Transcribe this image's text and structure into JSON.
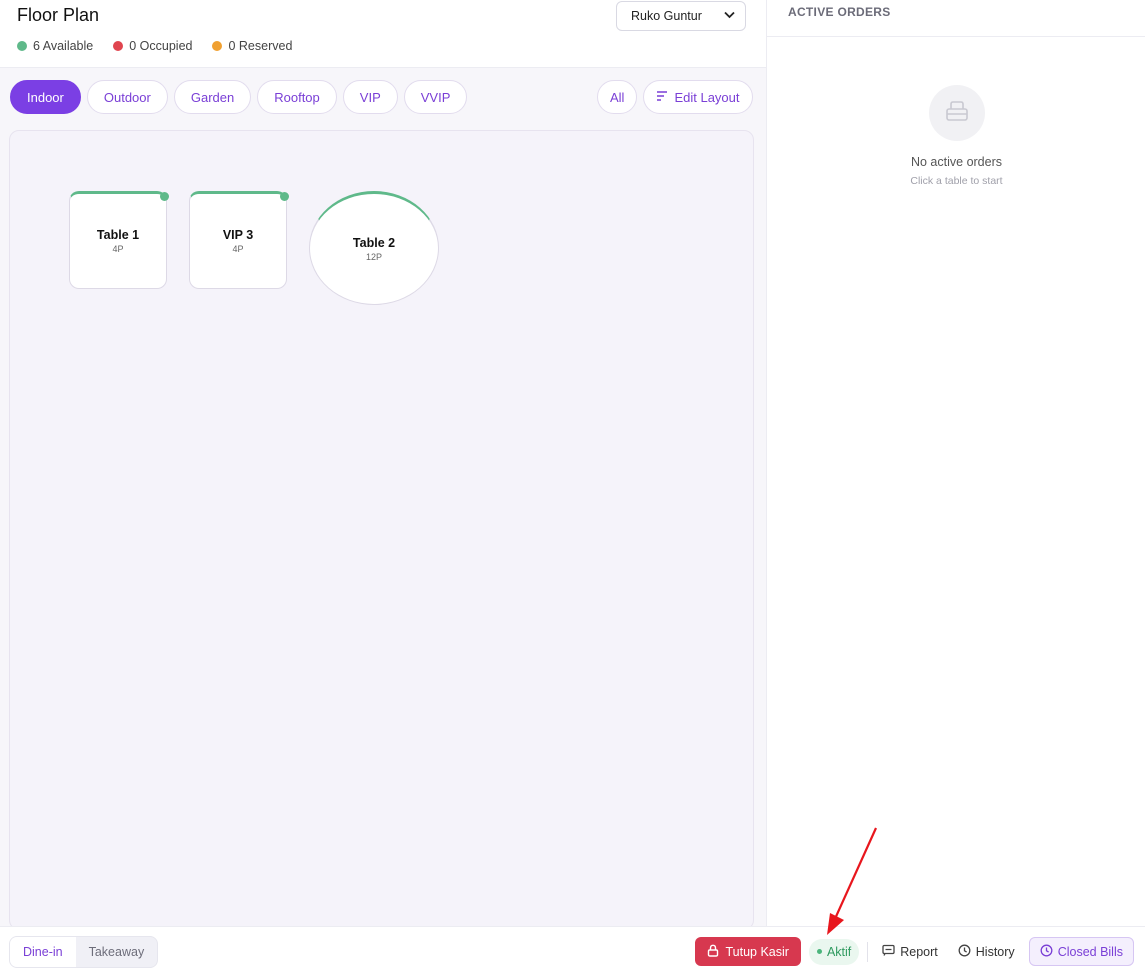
{
  "header": {
    "title": "Floor Plan",
    "legend": [
      {
        "label": "6 Available",
        "color": "#5fb98a"
      },
      {
        "label": "0 Occupied",
        "color": "#e0454f"
      },
      {
        "label": "0 Reserved",
        "color": "#f0a030"
      }
    ],
    "location": "Ruko Guntur"
  },
  "areas": [
    "Indoor",
    "Outdoor",
    "Garden",
    "Rooftop",
    "VIP",
    "VVIP"
  ],
  "active_area": "Indoor",
  "controls": {
    "all_label": "All",
    "edit_layout_label": "Edit Layout"
  },
  "tables": [
    {
      "name": "Table 1",
      "capacity": "4P",
      "shape": "square",
      "status": "available"
    },
    {
      "name": "VIP 3",
      "capacity": "4P",
      "shape": "square",
      "status": "available"
    },
    {
      "name": "Table 2",
      "capacity": "12P",
      "shape": "round",
      "status": "available"
    }
  ],
  "orders_panel": {
    "heading": "ACTIVE ORDERS",
    "empty_title": "No active orders",
    "empty_subtitle": "Click a table to start"
  },
  "footer": {
    "modes": [
      "Dine-in",
      "Takeaway"
    ],
    "active_mode": "Dine-in",
    "close_cashier_label": "Tutup Kasir",
    "status_label": "Aktif",
    "report_label": "Report",
    "history_label": "History",
    "closed_bills_label": "Closed Bills"
  },
  "colors": {
    "accent": "#7b3fe4",
    "danger": "#d7384f",
    "success": "#5fb98a"
  }
}
